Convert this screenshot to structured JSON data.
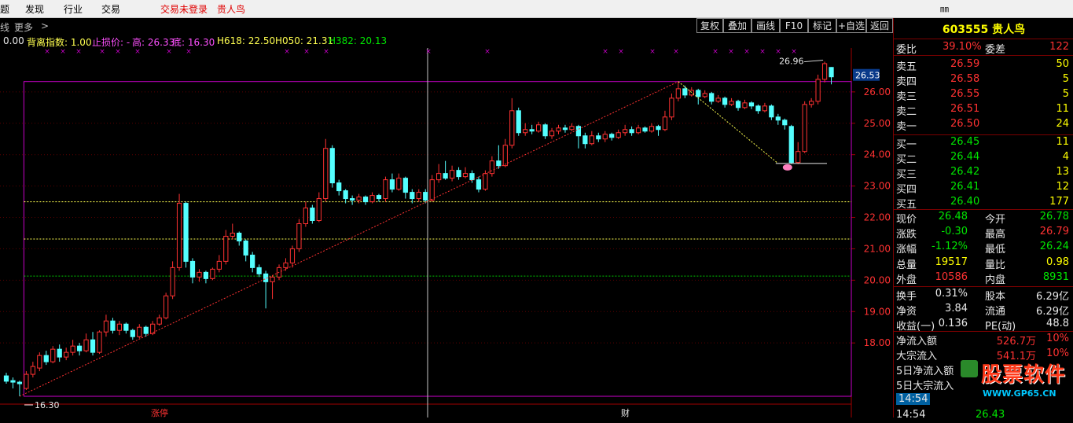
{
  "menu": {
    "items": [
      "题",
      "发现",
      "行业",
      "交易"
    ],
    "status": "交易未登录",
    "stock": "贵人鸟",
    "right_icon": "㎜"
  },
  "subbar": {
    "left1": "线",
    "left2": "更多",
    "arrow": ">"
  },
  "toolbar": [
    "复权",
    "叠加",
    "画线",
    "F10",
    "标记",
    "+自选",
    "返回"
  ],
  "indicator": {
    "v0": "0.00",
    "name": "背离指数: 1.00",
    "stop": "止损价: -",
    "high": "高: 26.33",
    "low": "底: 16.30",
    "h618": "H618: 22.50",
    "h050": "H050: 21.31",
    "h382": "H382: 20.13"
  },
  "chart_data": {
    "type": "candlestick",
    "title": "",
    "yticks": [
      "26.00",
      "25.00",
      "24.00",
      "23.00",
      "22.00",
      "21.00",
      "20.00",
      "19.00",
      "18.00"
    ],
    "ylim": [
      16.1,
      27.4
    ],
    "current_price_label": "26.53",
    "peak_label": "26.96",
    "low_label": "16.30",
    "fib_levels": [
      22.5,
      21.31,
      20.13
    ],
    "box": {
      "high": 26.33,
      "low": 16.3
    },
    "bottom_labels": [
      "涨停",
      "财"
    ],
    "candles": [
      [
        16.95,
        16.78,
        17.05,
        16.7
      ],
      [
        16.8,
        16.75,
        16.9,
        16.55
      ],
      [
        16.75,
        16.7,
        16.8,
        16.3
      ],
      [
        16.55,
        17.0,
        17.1,
        16.5
      ],
      [
        17.0,
        17.25,
        17.4,
        16.9
      ],
      [
        17.2,
        17.6,
        17.7,
        17.1
      ],
      [
        17.6,
        17.4,
        17.75,
        17.3
      ],
      [
        17.4,
        17.8,
        17.9,
        17.35
      ],
      [
        17.8,
        17.55,
        17.95,
        17.4
      ],
      [
        17.55,
        17.7,
        17.85,
        17.45
      ],
      [
        17.7,
        17.9,
        18.1,
        17.6
      ],
      [
        17.9,
        17.75,
        18.0,
        17.6
      ],
      [
        17.75,
        18.1,
        18.3,
        17.7
      ],
      [
        18.1,
        17.7,
        18.35,
        17.6
      ],
      [
        17.7,
        18.35,
        18.4,
        17.65
      ],
      [
        18.35,
        18.7,
        18.9,
        18.2
      ],
      [
        18.7,
        18.4,
        18.8,
        18.3
      ],
      [
        18.4,
        18.6,
        18.7,
        18.25
      ],
      [
        18.6,
        18.4,
        18.65,
        18.3
      ],
      [
        18.4,
        18.2,
        18.45,
        18.1
      ],
      [
        18.2,
        18.5,
        18.6,
        18.15
      ],
      [
        18.5,
        18.3,
        18.55,
        18.2
      ],
      [
        18.3,
        18.6,
        18.7,
        18.25
      ],
      [
        18.6,
        18.8,
        18.9,
        18.55
      ],
      [
        18.8,
        19.5,
        19.6,
        18.75
      ],
      [
        19.5,
        20.4,
        20.6,
        19.4
      ],
      [
        20.4,
        22.45,
        22.75,
        20.3
      ],
      [
        22.45,
        20.6,
        22.5,
        20.4
      ],
      [
        20.6,
        20.1,
        20.7,
        19.9
      ],
      [
        20.1,
        20.25,
        20.35,
        19.95
      ],
      [
        20.25,
        20.05,
        20.3,
        19.9
      ],
      [
        20.05,
        20.35,
        20.4,
        20.0
      ],
      [
        20.35,
        20.6,
        20.8,
        20.25
      ],
      [
        20.6,
        21.4,
        21.6,
        20.5
      ],
      [
        21.4,
        21.5,
        21.8,
        21.3
      ],
      [
        21.5,
        21.25,
        21.55,
        21.1
      ],
      [
        21.25,
        20.8,
        21.3,
        20.6
      ],
      [
        20.8,
        20.4,
        20.9,
        20.25
      ],
      [
        20.4,
        20.2,
        20.5,
        20.1
      ],
      [
        20.2,
        19.95,
        20.3,
        19.1
      ],
      [
        19.95,
        20.1,
        20.15,
        19.4
      ],
      [
        20.1,
        20.4,
        20.5,
        20.0
      ],
      [
        20.4,
        20.55,
        20.7,
        20.3
      ],
      [
        20.55,
        21.0,
        21.1,
        20.4
      ],
      [
        21.0,
        21.8,
        21.95,
        20.9
      ],
      [
        21.8,
        22.3,
        22.5,
        21.7
      ],
      [
        22.3,
        21.9,
        22.4,
        21.8
      ],
      [
        21.9,
        22.6,
        22.8,
        21.85
      ],
      [
        22.6,
        24.2,
        24.5,
        22.5
      ],
      [
        24.2,
        23.1,
        24.3,
        22.95
      ],
      [
        23.1,
        22.85,
        23.2,
        22.7
      ],
      [
        22.85,
        22.6,
        22.9,
        22.45
      ],
      [
        22.6,
        22.55,
        22.7,
        22.4
      ],
      [
        22.55,
        22.65,
        22.75,
        22.45
      ],
      [
        22.65,
        22.5,
        22.7,
        22.4
      ],
      [
        22.5,
        22.7,
        22.8,
        22.45
      ],
      [
        22.7,
        22.6,
        22.75,
        22.5
      ],
      [
        22.6,
        23.2,
        23.3,
        22.5
      ],
      [
        23.2,
        22.9,
        23.4,
        22.8
      ],
      [
        22.9,
        23.25,
        23.4,
        22.85
      ],
      [
        23.25,
        22.8,
        23.3,
        22.6
      ],
      [
        22.8,
        22.6,
        22.9,
        22.45
      ],
      [
        22.6,
        22.8,
        22.9,
        22.5
      ],
      [
        22.8,
        22.55,
        22.9,
        22.45
      ],
      [
        22.55,
        23.2,
        23.35,
        22.5
      ],
      [
        23.2,
        23.4,
        23.7,
        23.1
      ],
      [
        23.4,
        23.25,
        23.8,
        23.2
      ],
      [
        23.25,
        23.5,
        23.65,
        23.15
      ],
      [
        23.5,
        23.3,
        23.6,
        23.2
      ],
      [
        23.3,
        23.4,
        23.6,
        23.25
      ],
      [
        23.4,
        23.2,
        23.5,
        23.1
      ],
      [
        23.2,
        22.9,
        23.3,
        22.8
      ],
      [
        22.9,
        23.4,
        23.5,
        22.85
      ],
      [
        23.4,
        23.8,
        23.95,
        23.3
      ],
      [
        23.8,
        23.65,
        24.3,
        23.55
      ],
      [
        23.65,
        24.3,
        24.5,
        23.6
      ],
      [
        24.3,
        25.4,
        25.8,
        24.2
      ],
      [
        25.4,
        24.7,
        25.5,
        24.6
      ],
      [
        24.7,
        24.8,
        25.0,
        24.6
      ],
      [
        24.8,
        24.75,
        24.95,
        24.65
      ],
      [
        24.75,
        24.95,
        25.05,
        24.7
      ],
      [
        24.95,
        24.6,
        25.0,
        24.5
      ],
      [
        24.6,
        24.75,
        24.85,
        24.5
      ],
      [
        24.75,
        24.85,
        24.95,
        24.65
      ],
      [
        24.85,
        24.8,
        24.95,
        24.7
      ],
      [
        24.8,
        24.9,
        25.0,
        24.75
      ],
      [
        24.9,
        24.6,
        24.95,
        24.2
      ],
      [
        24.6,
        24.35,
        24.7,
        24.2
      ],
      [
        24.35,
        24.6,
        24.75,
        24.3
      ],
      [
        24.6,
        24.5,
        24.7,
        24.4
      ],
      [
        24.5,
        24.65,
        24.75,
        24.4
      ],
      [
        24.65,
        24.55,
        24.7,
        24.45
      ],
      [
        24.55,
        24.7,
        24.8,
        24.5
      ],
      [
        24.7,
        24.8,
        24.95,
        24.6
      ],
      [
        24.8,
        24.7,
        24.9,
        24.6
      ],
      [
        24.7,
        24.85,
        24.95,
        24.65
      ],
      [
        24.85,
        24.75,
        24.9,
        24.7
      ],
      [
        24.75,
        24.9,
        25.0,
        24.7
      ],
      [
        24.9,
        24.8,
        24.95,
        24.6
      ],
      [
        24.8,
        25.2,
        25.4,
        24.75
      ],
      [
        25.2,
        25.8,
        25.95,
        25.1
      ],
      [
        25.8,
        26.1,
        26.33,
        25.7
      ],
      [
        26.1,
        25.9,
        26.2,
        25.8
      ],
      [
        25.9,
        26.05,
        26.15,
        25.85
      ],
      [
        26.05,
        25.85,
        26.1,
        25.6
      ],
      [
        25.85,
        25.95,
        26.05,
        25.8
      ],
      [
        25.95,
        25.7,
        26.0,
        25.6
      ],
      [
        25.7,
        25.8,
        25.9,
        25.65
      ],
      [
        25.8,
        25.6,
        25.85,
        25.5
      ],
      [
        25.6,
        25.7,
        25.8,
        25.55
      ],
      [
        25.7,
        25.5,
        25.75,
        25.4
      ],
      [
        25.5,
        25.65,
        25.75,
        25.45
      ],
      [
        25.65,
        25.55,
        25.7,
        25.45
      ],
      [
        25.55,
        25.4,
        25.6,
        25.3
      ],
      [
        25.4,
        25.55,
        25.65,
        25.35
      ],
      [
        25.55,
        25.2,
        25.6,
        25.1
      ],
      [
        25.2,
        25.1,
        25.3,
        24.95
      ],
      [
        25.1,
        24.95,
        25.15,
        24.8
      ],
      [
        24.9,
        23.75,
        24.95,
        23.7
      ],
      [
        23.75,
        24.1,
        24.4,
        23.7
      ],
      [
        24.1,
        25.6,
        25.7,
        24.05
      ],
      [
        25.6,
        25.7,
        25.8,
        25.5
      ],
      [
        25.7,
        26.4,
        26.55,
        25.6
      ],
      [
        26.4,
        26.9,
        26.96,
        26.3
      ],
      [
        26.78,
        26.48,
        26.79,
        26.24
      ]
    ]
  },
  "quote": {
    "title": "603555 贵人鸟",
    "weibi_label": "委比",
    "weibi_value": "39.10%",
    "weicha_label": "委差",
    "weicha_value": "122",
    "asks": [
      {
        "label": "卖五",
        "price": "26.59",
        "vol": "50"
      },
      {
        "label": "卖四",
        "price": "26.58",
        "vol": "5"
      },
      {
        "label": "卖三",
        "price": "26.55",
        "vol": "5"
      },
      {
        "label": "卖二",
        "price": "26.51",
        "vol": "11"
      },
      {
        "label": "卖一",
        "price": "26.50",
        "vol": "24"
      }
    ],
    "bids": [
      {
        "label": "买一",
        "price": "26.45",
        "vol": "11"
      },
      {
        "label": "买二",
        "price": "26.44",
        "vol": "4"
      },
      {
        "label": "买三",
        "price": "26.42",
        "vol": "13"
      },
      {
        "label": "买四",
        "price": "26.41",
        "vol": "12"
      },
      {
        "label": "买五",
        "price": "26.40",
        "vol": "177"
      }
    ],
    "stats": [
      {
        "l1": "现价",
        "v1": "26.48",
        "l2": "今开",
        "v2": "26.78"
      },
      {
        "l1": "涨跌",
        "v1": "-0.30",
        "l2": "最高",
        "v2": "26.79"
      },
      {
        "l1": "涨幅",
        "v1": "-1.12%",
        "l2": "最低",
        "v2": "26.24"
      },
      {
        "l1": "总量",
        "v1": "19517",
        "l2": "量比",
        "v2": "0.98"
      },
      {
        "l1": "外盘",
        "v1": "10586",
        "l2": "内盘",
        "v2": "8931"
      }
    ],
    "stats2": [
      {
        "l1": "换手",
        "v1": "0.31%",
        "l2": "股本",
        "v2": "6.29亿"
      },
      {
        "l1": "净资",
        "v1": "3.84",
        "l2": "流通",
        "v2": "6.29亿"
      },
      {
        "l1": "收益(一)",
        "v1": "0.136",
        "l2": "PE(动)",
        "v2": "48.8"
      }
    ],
    "flows": [
      {
        "label": "净流入额",
        "value": "526.7万",
        "pct": "10%"
      },
      {
        "label": "大宗流入",
        "value": "541.1万",
        "pct": "10%"
      }
    ],
    "partial": [
      {
        "label": "5日净流入额"
      },
      {
        "label": "5日大宗流入"
      }
    ],
    "ticks": [
      {
        "time": "14:54"
      },
      {
        "time": "14:54",
        "price": "26.43"
      }
    ]
  },
  "watermark": {
    "big": "股票软件",
    "small": "WWW.GP65.CN"
  },
  "colors": {
    "up": "#ff3232",
    "down": "#54ffff",
    "box": "#c800c8",
    "fib": "#ffff50",
    "fib_green": "#00c800"
  }
}
